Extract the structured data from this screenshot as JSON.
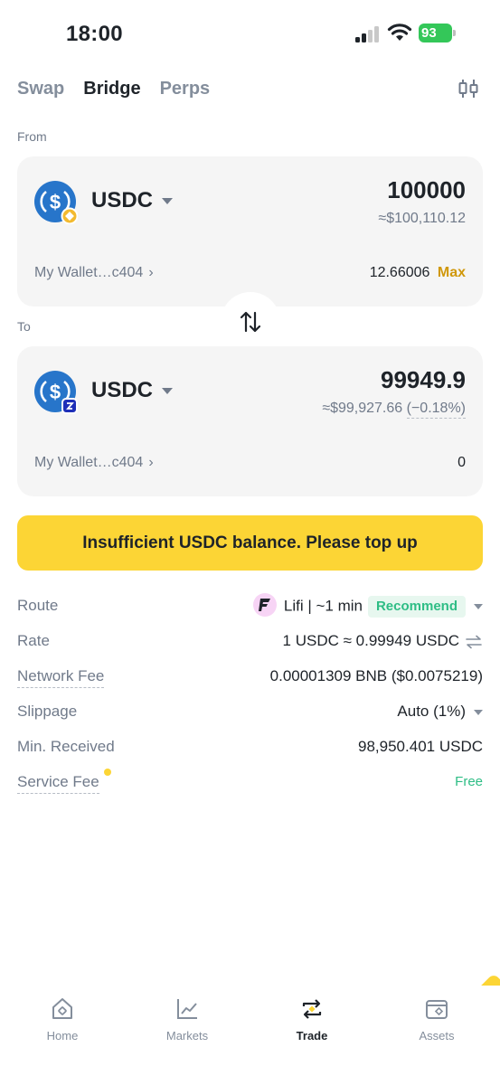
{
  "status_bar": {
    "time": "18:00",
    "battery": "93"
  },
  "tabs": [
    {
      "label": "Swap",
      "active": false
    },
    {
      "label": "Bridge",
      "active": true
    },
    {
      "label": "Perps",
      "active": false
    }
  ],
  "from": {
    "section_label": "From",
    "token": "USDC",
    "chain_badge": "bnb",
    "amount": "100000",
    "usd_value": "≈$100,110.12",
    "wallet": "My Wallet…c404",
    "balance": "12.66006",
    "max_label": "Max"
  },
  "to": {
    "section_label": "To",
    "token": "USDC",
    "chain_badge": "other",
    "amount": "99949.9",
    "usd_value": "≈$99,927.66",
    "usd_change": "(−0.18%)",
    "wallet": "My Wallet…c404",
    "balance": "0"
  },
  "cta_label": "Insufficient USDC balance. Please top up",
  "details": {
    "route_label": "Route",
    "route_value": "Lifi | ~1 min",
    "route_badge": "Recommend",
    "rate_label": "Rate",
    "rate_value": "1 USDC ≈ 0.99949 USDC",
    "network_fee_label": "Network Fee",
    "network_fee_value": "0.00001309 BNB ($0.0075219)",
    "slippage_label": "Slippage",
    "slippage_value": "Auto (1%)",
    "min_received_label": "Min. Received",
    "min_received_value": "98,950.401 USDC",
    "service_fee_label": "Service Fee",
    "service_fee_value": "Free"
  },
  "bottom_nav": [
    {
      "label": "Home",
      "icon": "home-icon",
      "active": false
    },
    {
      "label": "Markets",
      "icon": "markets-icon",
      "active": false
    },
    {
      "label": "Trade",
      "icon": "trade-icon",
      "active": true
    },
    {
      "label": "Assets",
      "icon": "assets-icon",
      "active": false
    }
  ],
  "colors": {
    "accent": "#fcd535",
    "positive": "#2ebd85",
    "max": "#d0980b",
    "usdc_blue": "#2775ca"
  }
}
